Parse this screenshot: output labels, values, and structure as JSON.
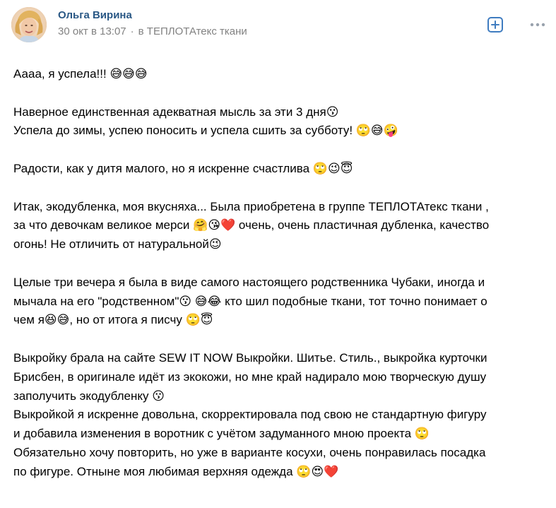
{
  "header": {
    "author": "Ольга Вирина",
    "date": "30 окт в 13:07",
    "separator": "·",
    "group": "в ТЕПЛОТАтекс ткани",
    "add_icon": "add-square-icon",
    "more_icon": "more-horizontal-icon",
    "accent_color": "#2a5885",
    "icon_color": "#3f7cc0"
  },
  "post": {
    "lines": [
      "Аааа, я успела!!! 😅😅😅",
      "",
      "Наверное единственная адекватная мысль за эти 3 дня😗",
      "Успела до зимы, успею поносить и успела сшить за субботу! 🙄😅🤪",
      "",
      "Радости, как у дитя малого, но я искренне счастлива 🙄😉😇",
      "",
      "Итак, экодубленка, моя вкусняха... Была приобретена в группе ТЕПЛОТАтекс ткани ,",
      "за что девочкам великое мерси 🤗😘❤️ очень, очень пластичная дубленка, качество",
      "огонь! Не отличить от натуральной😉",
      "",
      "Целые три вечера я была в виде самого настоящего родственника Чубаки, иногда и",
      "мычала на его \"родственном\"😗 😅😂 кто шил подобные ткани, тот точно понимает о",
      "чем я😆😅, но от итога я писчу 🙄😇",
      "",
      "Выкройку брала на сайте SEW IT NOW Выкройки. Шитье. Стиль., выкройка курточки",
      "Брисбен, в оригинале идёт из экокожи, но мне край надирало мою творческую душу",
      "заполучить экодубленку 😗",
      "Выкройкой я искренне довольна, скорректировала под свою не стандартную фигуру",
      "и добавила изменения в воротник с учётом задуманного мною проекта 🙄",
      "Обязательно хочу повторить, но уже в варианте косухи, очень понравилась посадка",
      "по фигуре. Отныне моя любимая верхняя одежда 🙄😍❤️"
    ]
  }
}
